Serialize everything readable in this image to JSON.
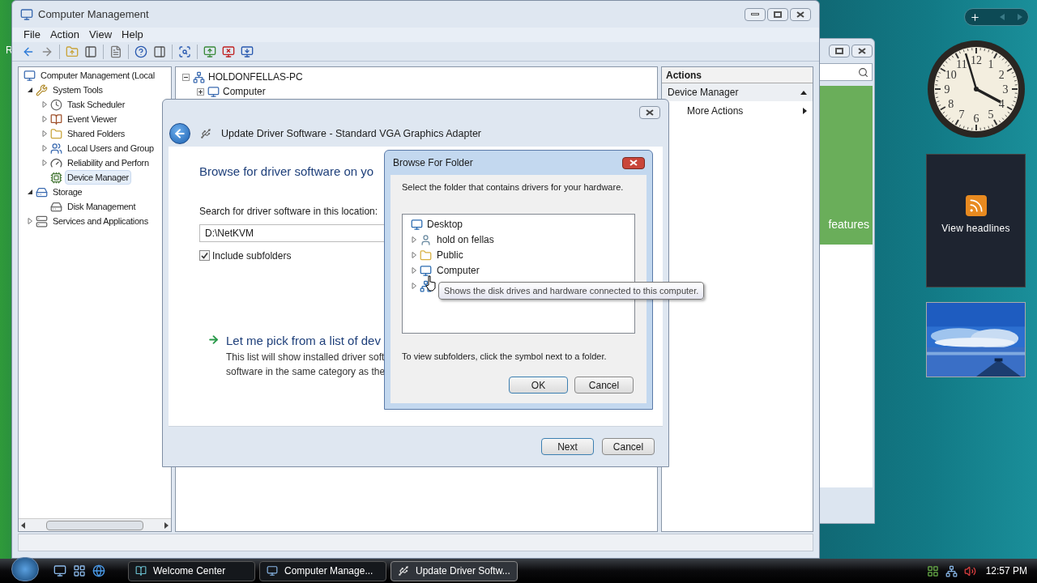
{
  "desktop": {
    "icon_label": "R"
  },
  "welcome_center": {
    "banner_text": "features"
  },
  "computer_management": {
    "title": "Computer Management",
    "menu": [
      "File",
      "Action",
      "View",
      "Help"
    ],
    "tree": [
      {
        "label": "Computer Management (Local",
        "kind": "root",
        "selected": false,
        "children": [
          {
            "label": "System Tools",
            "kind": "node",
            "expanded": true,
            "selected": false,
            "children": [
              {
                "label": "Task Scheduler",
                "kind": "node",
                "expanded": false,
                "selected": false
              },
              {
                "label": "Event Viewer",
                "kind": "node",
                "expanded": false,
                "selected": false
              },
              {
                "label": "Shared Folders",
                "kind": "node",
                "expanded": false,
                "selected": false
              },
              {
                "label": "Local Users and Group",
                "kind": "node",
                "expanded": false,
                "selected": false
              },
              {
                "label": "Reliability and Perforn",
                "kind": "node",
                "expanded": false,
                "selected": false
              },
              {
                "label": "Device Manager",
                "kind": "leaf",
                "selected": true
              }
            ]
          },
          {
            "label": "Storage",
            "kind": "node",
            "expanded": true,
            "selected": false,
            "children": [
              {
                "label": "Disk Management",
                "kind": "leaf",
                "selected": false
              }
            ]
          },
          {
            "label": "Services and Applications",
            "kind": "node",
            "expanded": false,
            "selected": false
          }
        ]
      }
    ],
    "device_tree": [
      {
        "label": "HOLDONFELLAS-PC",
        "expanded": true,
        "children": [
          {
            "label": "Computer",
            "expanded": false
          }
        ]
      }
    ],
    "actions": {
      "header": "Actions",
      "sections": [
        {
          "label": "Device Manager",
          "expanded": true,
          "items": [
            "More Actions"
          ]
        }
      ]
    }
  },
  "update_driver": {
    "title": "Update Driver Software - Standard VGA Graphics Adapter",
    "heading": "Browse for driver software on yo",
    "location_label": "Search for driver software in this location:",
    "location_value": "D:\\NetKVM",
    "include_subfolders": {
      "label": "Include subfolders",
      "checked": true
    },
    "pick_link": "Let me pick from a list of dev",
    "pick_description": [
      "This list will show installed driver soft",
      "software in the same category as the"
    ],
    "buttons": [
      "Next",
      "Cancel"
    ]
  },
  "browse_folder": {
    "title": "Browse For Folder",
    "instruction": "Select the folder that contains drivers for your hardware.",
    "tree": {
      "label": "Desktop",
      "children": [
        {
          "label": "hold on fellas",
          "expanded": false
        },
        {
          "label": "Public",
          "expanded": false
        },
        {
          "label": "Computer",
          "expanded": false
        }
      ]
    },
    "hint": "To view subfolders, click the symbol next to a folder.",
    "buttons": [
      "OK",
      "Cancel"
    ]
  },
  "tooltip": "Shows the disk drives and hardware connected to this computer.",
  "gadgets": {
    "clock_numerals": [
      "11",
      "12",
      "1",
      "10",
      "2",
      "9",
      "3",
      "8",
      "4",
      "7",
      "5",
      "6"
    ],
    "feed_label": "View headlines"
  },
  "taskbar": {
    "buttons": [
      {
        "label": "Welcome Center",
        "selected": false
      },
      {
        "label": "Computer Manage...",
        "selected": false
      },
      {
        "label": "Update Driver Softw...",
        "selected": true
      }
    ],
    "time": "12:57 PM"
  }
}
